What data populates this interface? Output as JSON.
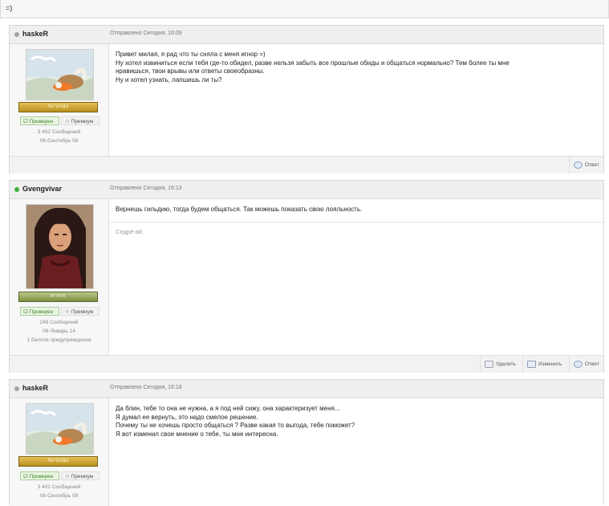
{
  "top_remnant": {
    "text": "=)"
  },
  "posts": [
    {
      "author": "haskeR",
      "date": "Отправлено Сегодня, 16:09",
      "rank": "ЛЕГЕНДА",
      "badge_verified": "Проверен",
      "badge_premium": "Премиум",
      "messages_count": "3 402 Сообщений",
      "joined": "08-Сентябрь 08",
      "lines": [
        "Привет милая, я рад что ты сняла с меня игнор =)",
        "Ну хотел извиниться если тебя где-то обидел, разве нельзя забыть все прошлые обиды и общаться нормально? Тем более ты мне",
        "нравишься, твои врывы или ответы своеобразны.",
        "Ну и хотел узнать, лапшишь ли ты?"
      ],
      "actions": {
        "reply": "Ответ"
      }
    },
    {
      "author": "Gvengvivar",
      "date": "Отправлено Сегодня, 16:13",
      "rank": "ИГРОК",
      "badge_verified": "Проверен",
      "badge_premium": "Премиум",
      "messages_count": "248 Сообщений",
      "joined": "06-Январь 14",
      "warnings": "1 баллов предупреждения",
      "lines": [
        "Вернешь гильдию, тогда будем общаться. Так можешь показать свою лояльность."
      ],
      "signature": "Седрё-ай.",
      "actions": {
        "delete": "Удалить",
        "edit": "Изменить",
        "reply": "Ответ"
      }
    },
    {
      "author": "haskeR",
      "date": "Отправлено Сегодня, 16:18",
      "rank": "ЛЕГЕНДА",
      "badge_verified": "Проверен",
      "badge_premium": "Премиум",
      "messages_count": "3 402 Сообщений",
      "joined": "08-Сентябрь 08",
      "lines": [
        "Да блин, тебе то она не нужна, а я под ней сижу, она характеризует меня...",
        "Я думал ее вернуть, это надо смелое решение.",
        "Почему ты не хочешь просто общаться ? Разве какая то выгода, тебе поможет?",
        "Я вот изменил свое мнение о тебе, ты мне интересна."
      ]
    }
  ],
  "colors": {
    "online_dot": "#3db03a",
    "offline_dot": "#a3a3a3",
    "verified_green": "#3c7d2a",
    "rank_gold": "#c9a232",
    "rank_olive": "#8fa04c"
  },
  "icons": [
    "status-offline-icon",
    "status-online-icon",
    "check-icon",
    "star-icon",
    "reply-icon",
    "edit-icon",
    "delete-icon"
  ]
}
